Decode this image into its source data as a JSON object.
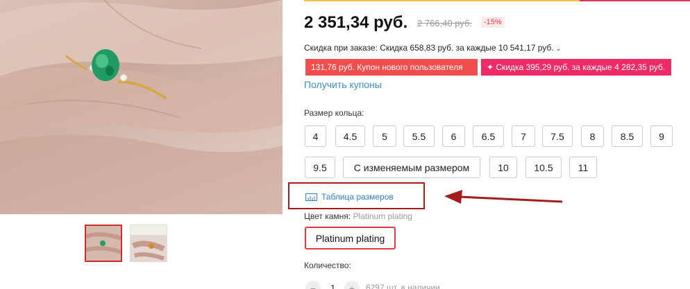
{
  "gallery": {
    "main_image": "emerald-ring-on-hand",
    "thumbnails": [
      {
        "name": "ring-closeup",
        "active": true
      },
      {
        "name": "ring-on-hand-box",
        "active": false
      }
    ]
  },
  "product": {
    "price": "2 351,34 руб.",
    "old_price": "2 766,40 руб.",
    "discount": "-15%",
    "order_discount": "Скидка при заказе: Скидка 658,83 руб. за каждые 10 541,17 руб.",
    "coupons": [
      "131,76 руб. Купон нового пользователя",
      "✦ Скидка 395,29 руб. за каждые 4 282,35 руб."
    ],
    "get_coupons": "Получить купоны",
    "ring_size_label": "Размер кольца:",
    "sizes": [
      "4",
      "4.5",
      "5",
      "5.5",
      "6",
      "6.5",
      "7",
      "7.5",
      "8",
      "8.5",
      "9",
      "9.5",
      "С изменяемым размером",
      "10",
      "10.5",
      "11"
    ],
    "size_table": "Таблица размеров",
    "stone_label": "Цвет камня:",
    "stone_value": "Platinum plating",
    "stone_option": "Platinum plating",
    "quantity_label": "Количество:",
    "quantity": "1",
    "quantity_minus": "−",
    "quantity_plus": "+",
    "stock": "6297 шт. в наличии"
  },
  "colors": {
    "accent_red": "#e4393c",
    "coupon_red": "#f24d4d",
    "coupon_pink": "#ee2a67",
    "link_blue": "#3a8ec9",
    "annotation_red": "#a51c1c"
  }
}
